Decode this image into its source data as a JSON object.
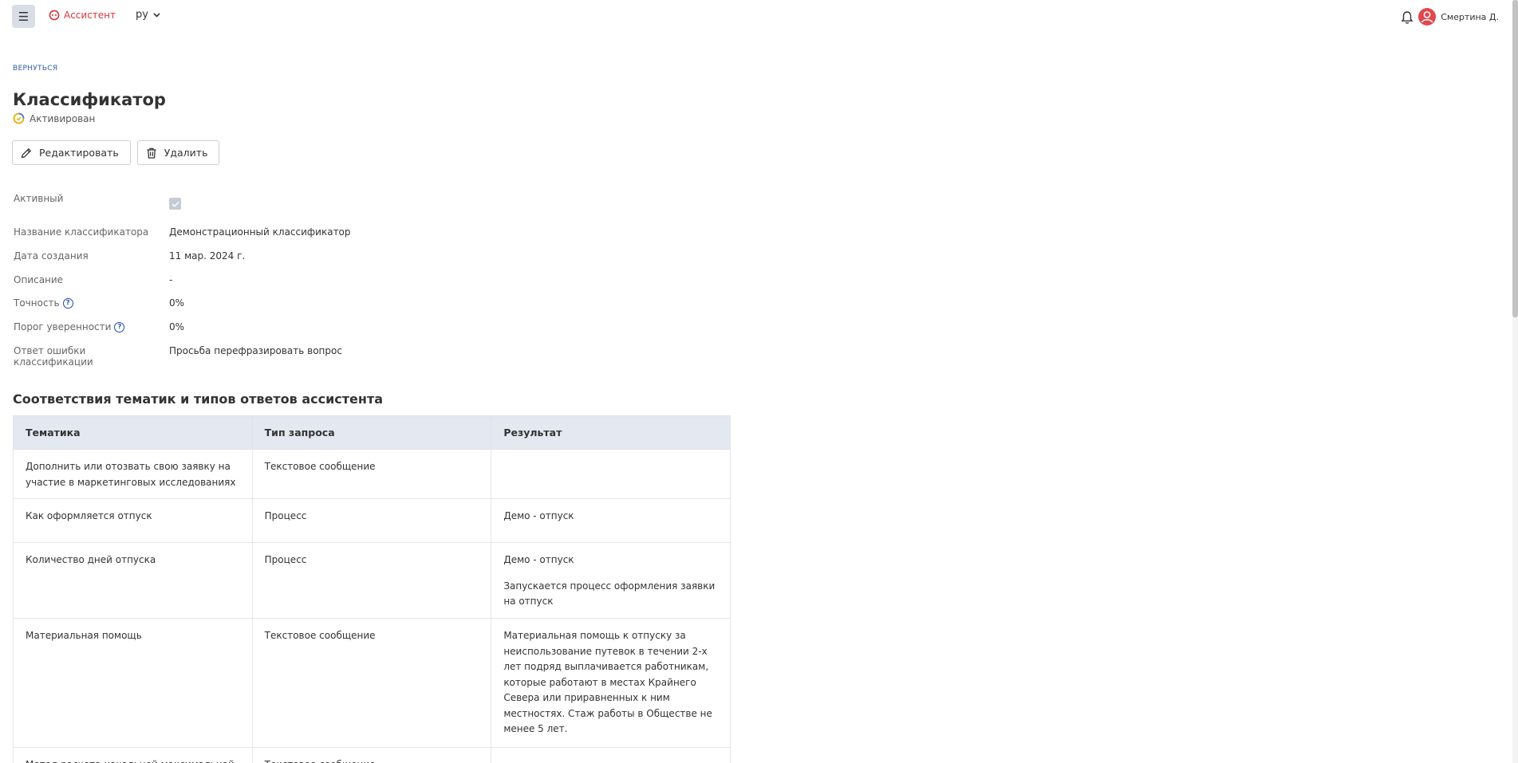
{
  "header": {
    "brand": "Ассистент",
    "language": "ру",
    "user_name": "Смертина Д.",
    "accent_color": "#d9343b"
  },
  "back_link": "ВЕРНУТЬСЯ",
  "page": {
    "title": "Классификатор",
    "status": "Активирован"
  },
  "actions": {
    "edit_label": "Редактировать",
    "delete_label": "Удалить"
  },
  "fields": {
    "active": {
      "label": "Активный",
      "checked": true
    },
    "name": {
      "label": "Название классификатора",
      "value": "Демонстрационный классификатор"
    },
    "created": {
      "label": "Дата создания",
      "value": "11 мар. 2024 г."
    },
    "description": {
      "label": "Описание",
      "value": "-"
    },
    "accuracy": {
      "label": "Точность",
      "value": "0%"
    },
    "threshold": {
      "label": "Порог уверенности",
      "value": "0%"
    },
    "error_answer": {
      "label": "Ответ ошибки классификации",
      "value": "Просьба перефразировать вопрос"
    }
  },
  "section_title": "Соответствия тематик и типов ответов ассистента",
  "table": {
    "headers": [
      "Тематика",
      "Тип запроса",
      "Результат"
    ],
    "rows": [
      {
        "topic": "Дополнить или отозвать свою заявку на участие в маркетинговых исследованиях",
        "type": "Текстовое сообщение",
        "result": []
      },
      {
        "topic": "Как оформляется отпуск",
        "type": "Процесс",
        "result": [
          "Демо - отпуск"
        ]
      },
      {
        "topic": "Количество дней отпуска",
        "type": "Процесс",
        "result": [
          "Демо - отпуск",
          "Запускается процесс оформления заявки на отпуск"
        ]
      },
      {
        "topic": "Материальная помощь",
        "type": "Текстовое сообщение",
        "result": [
          "Материальная помощь к отпуску за неиспользование путевок в течении 2-х лет подряд выплачивается работникам, которые работают в местах Крайнего Севера или приравненных к ним местностях. Стаж работы в Обществе не менее 5 лет."
        ]
      },
      {
        "topic": "Метод расчета начальной максимальной",
        "type": "Текстовое сообщение",
        "result": []
      }
    ]
  }
}
